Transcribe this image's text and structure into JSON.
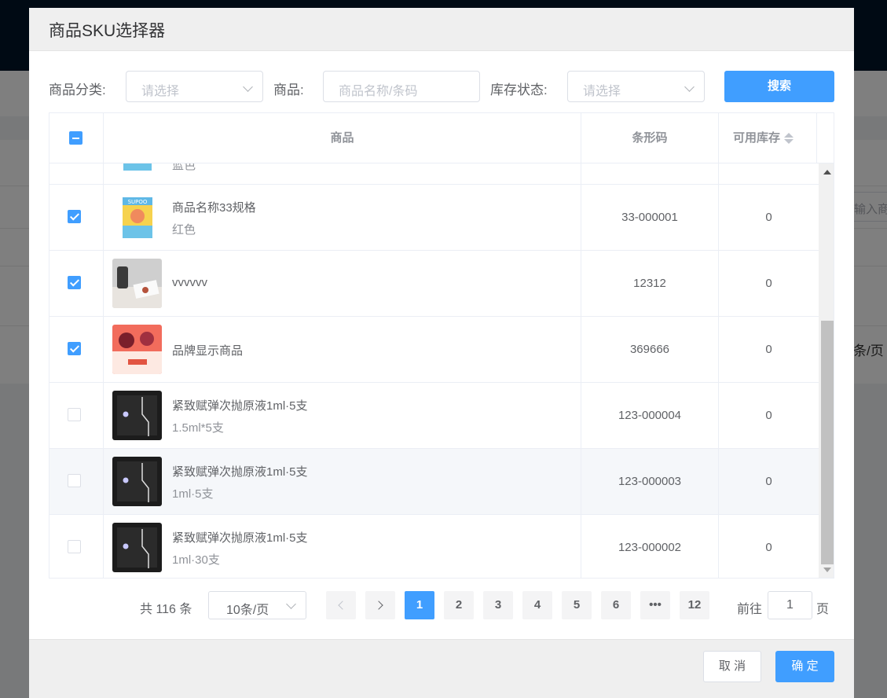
{
  "dialog": {
    "title": "商品SKU选择器"
  },
  "filters": {
    "category_label": "商品分类:",
    "category_placeholder": "请选择",
    "product_label": "商品:",
    "product_placeholder": "商品名称/条码",
    "stock_label": "库存状态:",
    "stock_placeholder": "请选择",
    "search_label": "搜索"
  },
  "table": {
    "headers": {
      "product": "商品",
      "barcode": "条形码",
      "stock": "可用库存"
    },
    "partial_row": {
      "spec": "蓝色"
    },
    "rows": [
      {
        "name": "商品名称33规格",
        "spec": "红色",
        "barcode": "33-000001",
        "stock": "0",
        "checked": true,
        "thumb": "toy-box-image"
      },
      {
        "name": "vvvvvv",
        "spec": "",
        "barcode": "12312",
        "stock": "0",
        "checked": true,
        "thumb": "kitchen-photo-image"
      },
      {
        "name": "品牌显示商品",
        "spec": "",
        "barcode": "369666",
        "stock": "0",
        "checked": true,
        "thumb": "drink-poster-image"
      },
      {
        "name": "紧致赋弹次抛原液1ml·5支",
        "spec": "1.5ml*5支",
        "barcode": "123-000004",
        "stock": "0",
        "checked": false,
        "thumb": "black-box-image"
      },
      {
        "name": "紧致赋弹次抛原液1ml·5支",
        "spec": "1ml·5支",
        "barcode": "123-000003",
        "stock": "0",
        "checked": false,
        "thumb": "black-box-image"
      },
      {
        "name": "紧致赋弹次抛原液1ml·5支",
        "spec": "1ml·30支",
        "barcode": "123-000002",
        "stock": "0",
        "checked": false,
        "thumb": "black-box-image"
      }
    ]
  },
  "pagination": {
    "total": "共 116 条",
    "page_size": "10条/页",
    "pages": [
      "1",
      "2",
      "3",
      "4",
      "5",
      "6",
      "•••",
      "12"
    ],
    "current": "1",
    "goto_label": "前往",
    "goto_value": "1",
    "goto_unit": "页"
  },
  "footer": {
    "cancel_label": "取 消",
    "confirm_label": "确 定"
  },
  "background": {
    "input_placeholder": "输入商",
    "page_size_fragment": "条/页"
  },
  "colors": {
    "primary": "#409eff",
    "mask": "rgba(0,0,0,0.5)",
    "header_bg": "#efefef"
  }
}
